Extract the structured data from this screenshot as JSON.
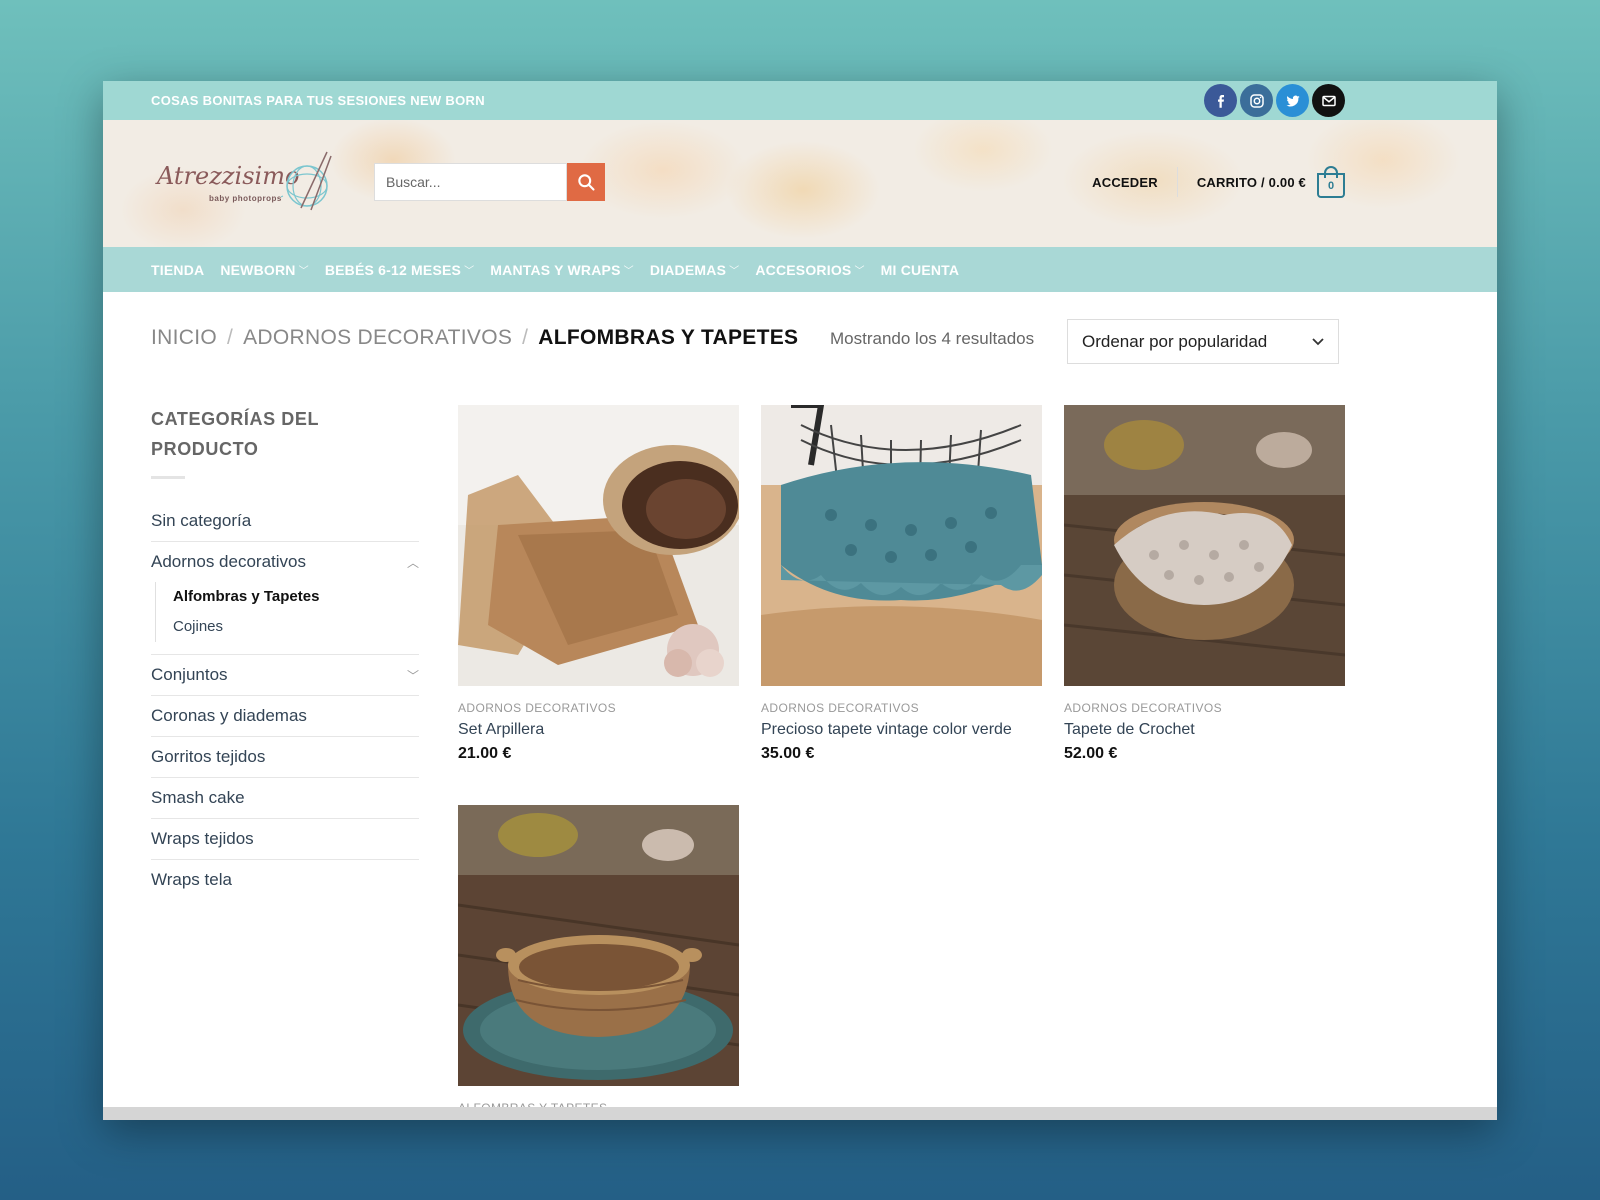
{
  "topbar": {
    "tagline": "COSAS BONITAS PARA TUS SESIONES NEW BORN",
    "social_icons": [
      "facebook-icon",
      "instagram-icon",
      "twitter-icon",
      "email-icon"
    ]
  },
  "header": {
    "logo_text": "Atrezzisimo",
    "logo_subtext": "baby photoprops",
    "search_placeholder": "Buscar...",
    "login_label": "ACCEDER",
    "cart_label": "CARRITO / 0.00 €",
    "cart_count": "0"
  },
  "nav": {
    "items": [
      {
        "label": "TIENDA",
        "has_dropdown": false
      },
      {
        "label": "NEWBORN",
        "has_dropdown": true
      },
      {
        "label": "BEBÉS 6-12 MESES",
        "has_dropdown": true
      },
      {
        "label": "MANTAS Y WRAPS",
        "has_dropdown": true
      },
      {
        "label": "DIADEMAS",
        "has_dropdown": true
      },
      {
        "label": "ACCESORIOS",
        "has_dropdown": true
      },
      {
        "label": "MI CUENTA",
        "has_dropdown": false
      }
    ]
  },
  "breadcrumb": {
    "items": [
      "INICIO",
      "ADORNOS DECORATIVOS"
    ],
    "separator": "/",
    "current": "ALFOMBRAS Y TAPETES"
  },
  "results": {
    "count_text": "Mostrando los 4 resultados",
    "sort_selected": "Ordenar por popularidad"
  },
  "sidebar": {
    "title": "CATEGORÍAS DEL PRODUCTO",
    "categories": [
      {
        "label": "Sin categoría"
      },
      {
        "label": "Adornos decorativos",
        "expanded": true,
        "children": [
          {
            "label": "Alfombras y Tapetes",
            "active": true
          },
          {
            "label": "Cojines",
            "active": false
          }
        ]
      },
      {
        "label": "Conjuntos",
        "expanded": false
      },
      {
        "label": "Coronas y diademas"
      },
      {
        "label": "Gorritos tejidos"
      },
      {
        "label": "Smash cake"
      },
      {
        "label": "Wraps tejidos"
      },
      {
        "label": "Wraps tela"
      }
    ]
  },
  "products": [
    {
      "category": "ADORNOS DECORATIVOS",
      "name": "Set Arpillera",
      "price": "21.00 €"
    },
    {
      "category": "ADORNOS DECORATIVOS",
      "name": "Precioso tapete vintage color verde",
      "price": "35.00 €"
    },
    {
      "category": "ADORNOS DECORATIVOS",
      "name": "Tapete de Crochet",
      "price": "52.00 €"
    },
    {
      "category": "ALFOMBRAS Y TAPETES",
      "name": "",
      "price": ""
    }
  ],
  "colors": {
    "topbar": "#9fd8d3",
    "nav": "#a9d8d6",
    "search_button": "#e06a44",
    "accent": "#2d7d93"
  }
}
